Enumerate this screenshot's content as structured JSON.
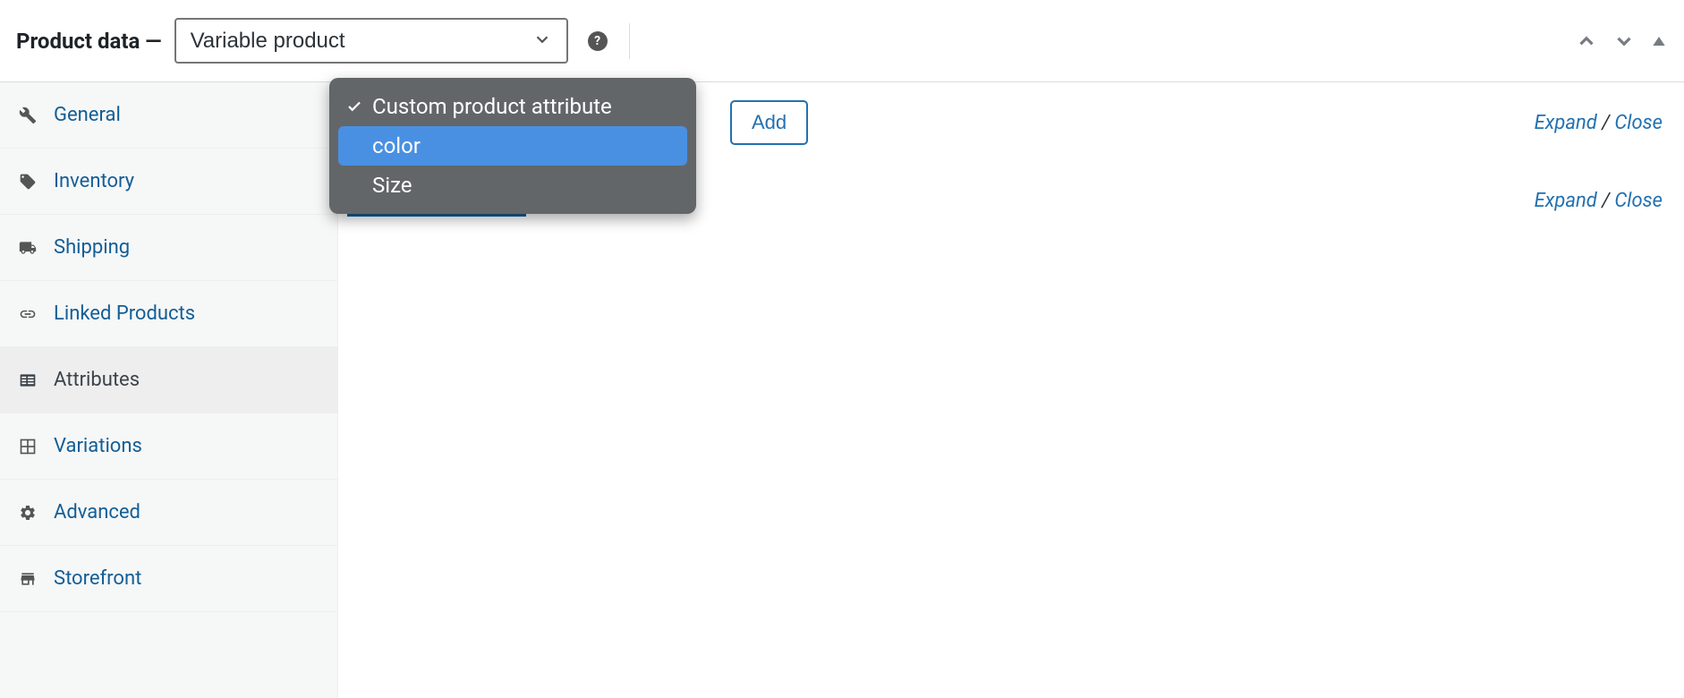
{
  "header": {
    "title": "Product data —",
    "product_type": "Variable product"
  },
  "sidebar": {
    "items": [
      {
        "label": "General"
      },
      {
        "label": "Inventory"
      },
      {
        "label": "Shipping"
      },
      {
        "label": "Linked Products"
      },
      {
        "label": "Attributes"
      },
      {
        "label": "Variations"
      },
      {
        "label": "Advanced"
      },
      {
        "label": "Storefront"
      }
    ]
  },
  "content": {
    "add_button": "Add",
    "expand": "Expand",
    "close": "Close",
    "separator": " / "
  },
  "dropdown": {
    "options": [
      {
        "label": "Custom product attribute",
        "selected": true
      },
      {
        "label": "color",
        "highlighted": true
      },
      {
        "label": "Size"
      }
    ]
  }
}
